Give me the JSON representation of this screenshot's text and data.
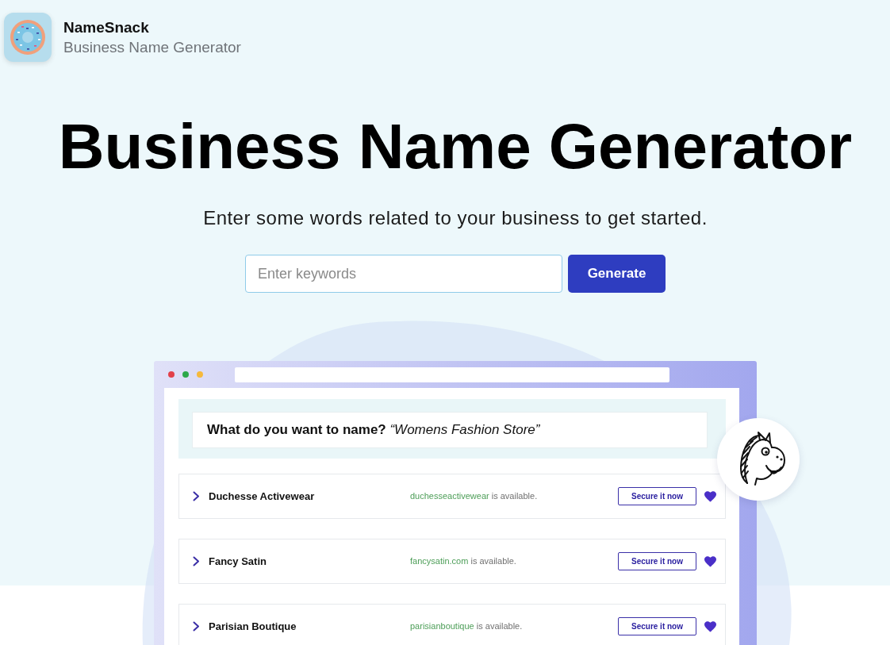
{
  "brand": {
    "name": "NameSnack",
    "tagline": "Business Name Generator"
  },
  "hero": {
    "title": "Business Name Generator",
    "subtitle": "Enter some words related to your business to get started."
  },
  "search": {
    "placeholder": "Enter keywords",
    "button": "Generate"
  },
  "preview": {
    "prompt": "**What do you want to name?** *“Womens Fashion Store”*",
    "results": [
      {
        "name": "Duchesse Activewear",
        "domain": "duchesseactivewear",
        "status": "is available.",
        "action": "Secure it now"
      },
      {
        "name": "Fancy Satin",
        "domain": "fancysatin.com",
        "status": "is available.",
        "action": "Secure it now"
      },
      {
        "name": "Parisian Boutique",
        "domain": "parisianboutique",
        "status": "is available.",
        "action": "Secure it now"
      }
    ]
  }
}
